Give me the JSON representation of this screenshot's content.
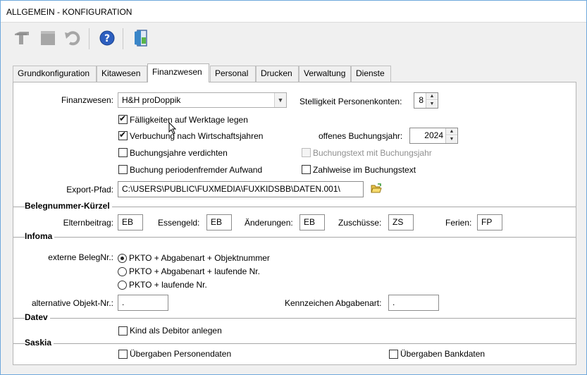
{
  "window": {
    "title": "ALLGEMEIN - KONFIGURATION"
  },
  "toolbar": {
    "icons": [
      "save-icon",
      "stop-icon",
      "undo-icon",
      "help-icon",
      "exit-door-icon"
    ]
  },
  "tabs": [
    {
      "label": "Grundkonfiguration"
    },
    {
      "label": "Kitawesen"
    },
    {
      "label": "Finanzwesen"
    },
    {
      "label": "Personal"
    },
    {
      "label": "Drucken"
    },
    {
      "label": "Verwaltung"
    },
    {
      "label": "Dienste"
    }
  ],
  "finanz": {
    "finanzwesen_label": "Finanzwesen:",
    "finanzwesen_value": "H&H proDoppik",
    "stelligkeit_label": "Stelligkeit Personenkonten:",
    "stelligkeit_value": "8",
    "faelligkeiten": "Fälligkeiten auf Werktage legen",
    "verbuchung": "Verbuchung nach Wirtschaftsjahren",
    "offenes_label": "offenes Buchungsjahr:",
    "offenes_value": "2024",
    "verdichten": "Buchungsjahre verdichten",
    "buchungstext": "Buchungstext mit Buchungsjahr",
    "periodenfremd": "Buchung periodenfremder Aufwand",
    "zahlweise": "Zahlweise im Buchungstext",
    "export_label": "Export-Pfad:",
    "export_value": "C:\\USERS\\PUBLIC\\FUXMEDIA\\FUXKIDSBB\\DATEN.001\\"
  },
  "beleg": {
    "title": "Belegnummer-Kürzel",
    "eltern_label": "Elternbeitrag:",
    "eltern_value": "EB",
    "essen_label": "Essengeld:",
    "essen_value": "EB",
    "aend_label": "Änderungen:",
    "aend_value": "EB",
    "zusch_label": "Zuschüsse:",
    "zusch_value": "ZS",
    "ferien_label": "Ferien:",
    "ferien_value": "FP"
  },
  "infoma": {
    "title": "Infoma",
    "extern_label": "externe BelegNr.:",
    "opt1": "PKTO + Abgabenart + Objektnummer",
    "opt2": "PKTO + Abgabenart + laufende Nr.",
    "opt3": "PKTO + laufende Nr.",
    "alt_label": "alternative Objekt-Nr.:",
    "alt_value": ".",
    "kenn_label": "Kennzeichen Abgabenart:",
    "kenn_value": "."
  },
  "datev": {
    "title": "Datev",
    "debitor": "Kind als Debitor anlegen"
  },
  "saskia": {
    "title": "Saskia",
    "personen": "Übergaben Personendaten",
    "bank": "Übergaben Bankdaten"
  }
}
